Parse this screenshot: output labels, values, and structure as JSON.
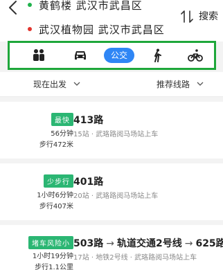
{
  "header": {
    "from": "黄鹤楼 武汉市武昌区",
    "to": "武汉植物园 武汉市武昌区",
    "search_label": "搜索"
  },
  "modes": {
    "active_label": "公交"
  },
  "filters": {
    "depart": "现在出发",
    "sort": "推荐线路"
  },
  "routes": [
    {
      "badge": "最快",
      "time": "56分钟",
      "walk": "步行472米",
      "title": "413路",
      "sub": "15站 · 武珞路阅马场站上车"
    },
    {
      "badge": "少步行",
      "time": "1小时6分钟",
      "walk": "步行407米",
      "title": "401路",
      "sub": "20站 · 武珞路阅马场站上车"
    },
    {
      "badge": "堵车风险小",
      "time": "1小时19分钟",
      "walk": "步行1.1公里",
      "title_parts": [
        "503路",
        "轨道交通2号线",
        "625路"
      ],
      "arrow": "→",
      "sub": "17站 · 地铁2号线 · 武珞路阅马场站上车"
    }
  ],
  "colors": {
    "accent_blue": "#2f86f5",
    "badge_green": "#2bb673",
    "highlight_border": "#1ea73a",
    "dot_start": "#20b24c",
    "dot_end": "#e2342d"
  }
}
